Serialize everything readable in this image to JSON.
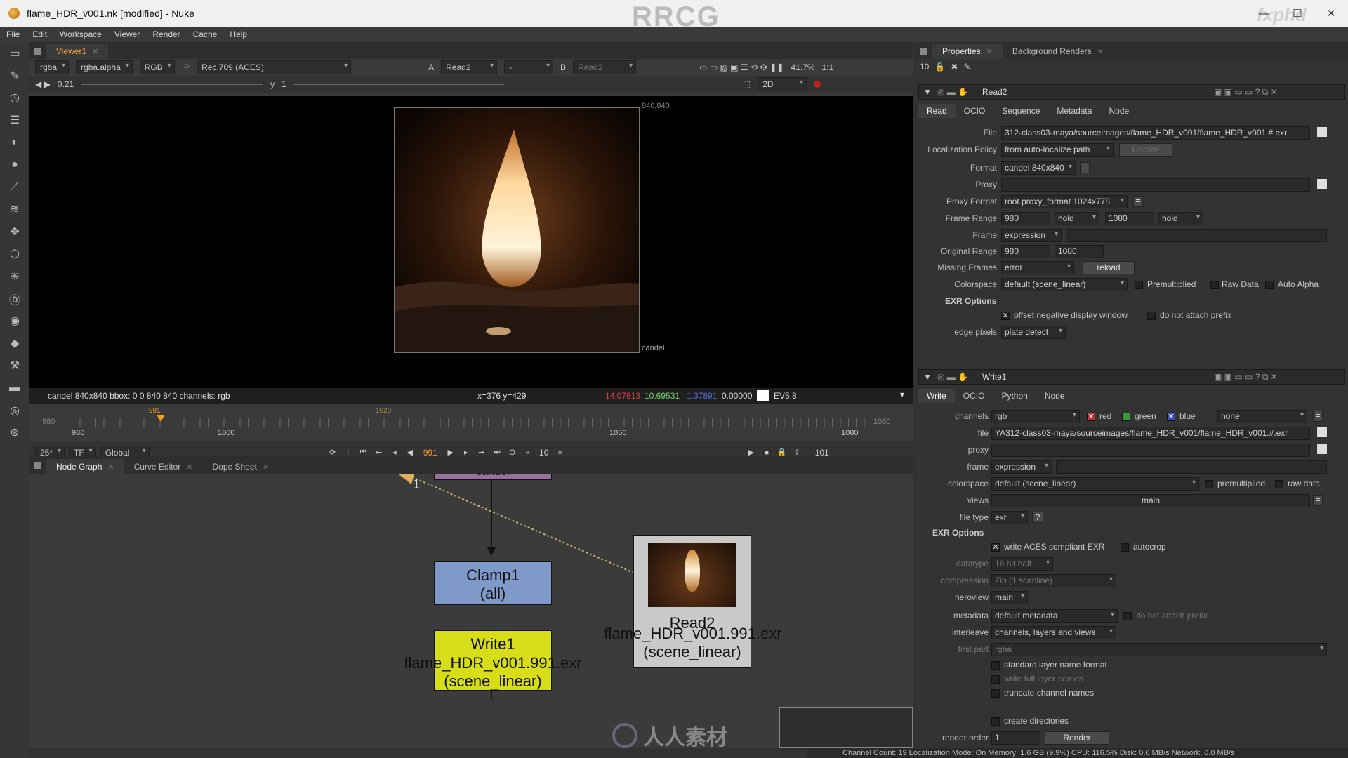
{
  "window": {
    "title": "flame_HDR_v001.nk [modified] - Nuke",
    "brand_watermark": "RRCG",
    "fxphd_logo": "fxphd"
  },
  "menu": [
    "File",
    "Edit",
    "Workspace",
    "Viewer",
    "Render",
    "Cache",
    "Help"
  ],
  "viewer": {
    "tab": "Viewer1",
    "channels": "rgba",
    "alpha": "rgba.alpha",
    "display": "RGB",
    "ip": "IP",
    "lut": "Rec.709 (ACES)",
    "a_label": "A",
    "a_input": "Read2",
    "dash": "-",
    "b_label": "B",
    "b_input": "Read2",
    "zoom": "41.7%",
    "ratio": "1:1",
    "gain_label": "0.21",
    "y_label": "y",
    "gamma": "1",
    "mode_2d": "2D",
    "format_label": "840,840",
    "node_label": "candel",
    "info_left": "candel 840x840  bbox: 0 0 840 840 channels: rgb",
    "coords": "x=376 y=429",
    "pixel_r": "14.07813",
    "pixel_g": "10.69531",
    "pixel_b": "1.37891",
    "pixel_a": "0.00000",
    "ev": "EV5.8"
  },
  "timeline": {
    "range_start_left": "980",
    "tick_980": "980",
    "tick_1000": "1000",
    "tick_1050": "1050",
    "tick_1080": "1080",
    "range_end_right": "1080",
    "marker_frame": "991",
    "marker_top": "1020",
    "fps": "25*",
    "tf": "TF",
    "global": "Global",
    "current_frame": "991",
    "step": "10",
    "end_frame": "101",
    "in_marker": "I",
    "out_marker": "O"
  },
  "nodegraph": {
    "tabs": [
      "Node Graph",
      "Curve Editor",
      "Dope Sheet"
    ],
    "clamp_title": "Clamp1",
    "clamp_sub": "(all)",
    "write_title": "Write1",
    "write_file": "flame_HDR_v001.991.exr",
    "write_cs": "(scene_linear)",
    "read_title": "Read2",
    "read_file": "flame_HDR_v001.991.exr",
    "read_cs": "(scene_linear)",
    "top_node": "candel",
    "pipe_label": "1",
    "watermark_cn": "人人素材"
  },
  "properties": {
    "tabs": [
      "Properties",
      "Background Renders"
    ],
    "max_panels": "10",
    "read": {
      "name": "Read2",
      "tabs": [
        "Read",
        "OCIO",
        "Sequence",
        "Metadata",
        "Node"
      ],
      "file_label": "File",
      "file": "312-class03-maya/sourceimages/flame_HDR_v001/flame_HDR_v001.#.exr",
      "loc_label": "Localization Policy",
      "loc": "from auto-localize path",
      "update": "Update",
      "format_label": "Format",
      "format": "candel 840x840",
      "proxy_label": "Proxy",
      "proxy_format_label": "Proxy Format",
      "proxy_format": "root.proxy_format 1024x778",
      "frame_range_label": "Frame Range",
      "fr_start": "980",
      "fr_before": "hold",
      "fr_end": "1080",
      "fr_after": "hold",
      "frame_label": "Frame",
      "frame": "expression",
      "orig_label": "Original Range",
      "orig_start": "980",
      "orig_end": "1080",
      "missing_label": "Missing Frames",
      "missing": "error",
      "reload": "reload",
      "cs_label": "Colorspace",
      "cs": "default (scene_linear)",
      "premult": "Premultiplied",
      "raw": "Raw Data",
      "auto_alpha": "Auto Alpha",
      "exr_options": "EXR Options",
      "offset": "offset negative display window",
      "no_prefix": "do not attach prefix",
      "edge_label": "edge pixels",
      "edge": "plate detect"
    },
    "write": {
      "name": "Write1",
      "tabs": [
        "Write",
        "OCIO",
        "Python",
        "Node"
      ],
      "channels_label": "channels",
      "channels": "rgb",
      "red": "red",
      "green": "green",
      "blue": "blue",
      "none": "none",
      "file_label": "file",
      "file": "YA312-class03-maya/sourceimages/flame_HDR_v001/flame_HDR_v001.#.exr",
      "proxy_label": "proxy",
      "frame_label": "frame",
      "frame": "expression",
      "cs_label": "colorspace",
      "cs": "default (scene_linear)",
      "premult": "premultiplied",
      "raw": "raw data",
      "views_label": "views",
      "views": "main",
      "filetype_label": "file type",
      "filetype": "exr",
      "help": "?",
      "exr_options": "EXR Options",
      "aces": "write ACES compliant EXR",
      "autocrop": "autocrop",
      "datatype_label": "datatype",
      "datatype": "16 bit half",
      "compression_label": "compression",
      "compression": "Zip (1 scanline)",
      "heroview_label": "heroview",
      "heroview": "main",
      "metadata_label": "metadata",
      "metadata": "default metadata",
      "no_prefix": "do not attach prefix",
      "interleave_label": "interleave",
      "interleave": "channels, layers and views",
      "first_part_label": "first part",
      "first_part": "rgba",
      "std_layer": "standard layer name format",
      "full_layer": "write full layer names",
      "truncate": "truncate channel names",
      "create_dirs": "create directories",
      "render_order_label": "render order",
      "render_order": "1",
      "render": "Render"
    }
  },
  "status": "Channel Count: 19  Localization Mode: On  Memory: 1.6 GB (9.9%)  CPU: 116.5%  Disk: 0.0 MB/s  Network: 0.0 MB/s",
  "colors": {
    "accent_orange": "#f0a020",
    "write_node": "#d7dd18",
    "clamp_node": "#7f99c9",
    "read_node": "#c9c9c9"
  }
}
